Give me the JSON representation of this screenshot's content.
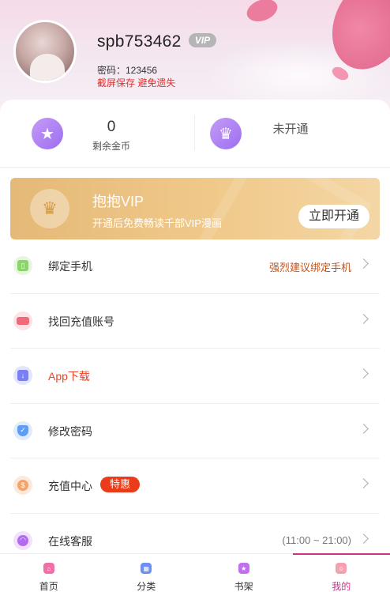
{
  "profile": {
    "username": "spb753462",
    "vip_badge": "VIP",
    "password_line": "密码：123456",
    "screenshot_tip": "截屏保存 避免遗失"
  },
  "stats": {
    "coin_value": "0",
    "coin_label": "剩余金币",
    "vip_status": "未开通"
  },
  "vip_banner": {
    "title": "抱抱VIP",
    "subtitle": "开通后免费畅读千部VIP漫画",
    "button": "立即开通"
  },
  "menu": [
    {
      "label": "绑定手机",
      "hint": "强烈建议绑定手机",
      "icon": "phone-icon",
      "color": "#8bd46a"
    },
    {
      "label": "找回充值账号",
      "hint": "",
      "icon": "tag-icon",
      "color": "#f06a7a"
    },
    {
      "label": "App下载",
      "hint": "",
      "icon": "download-icon",
      "color": "#7b7ff5"
    },
    {
      "label": "修改密码",
      "hint": "",
      "icon": "shield-icon",
      "color": "#5f9df5"
    },
    {
      "label": "充值中心",
      "hint": "",
      "tag": "特惠",
      "icon": "moneybag-icon",
      "color": "#f5a36a"
    },
    {
      "label": "在线客服",
      "hint": "(11:00 ~ 21:00)",
      "icon": "headset-icon",
      "color": "#b26af0"
    }
  ],
  "tabbar": [
    {
      "label": "首页",
      "icon": "home-icon",
      "color": "#ef6fa8"
    },
    {
      "label": "分类",
      "icon": "category-icon",
      "color": "#6d8ff2"
    },
    {
      "label": "书架",
      "icon": "bookshelf-icon",
      "color": "#c16ef0"
    },
    {
      "label": "我的",
      "icon": "profile-icon",
      "color": "#f5a0b0"
    }
  ],
  "colors": {
    "accent": "#d12f8a",
    "danger": "#e0302f",
    "vip_gold": "#e5b977"
  }
}
